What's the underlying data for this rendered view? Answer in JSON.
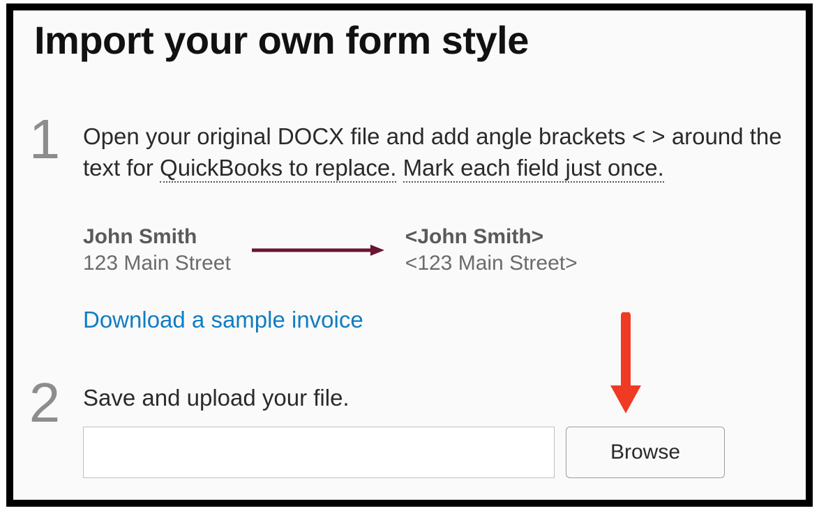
{
  "title": "Import your own form style",
  "step1": {
    "num": "1",
    "text_before": "Open your original DOCX file and add angle brackets < > around the text for ",
    "dotted1": "QuickBooks to replace.",
    "space": " ",
    "dotted2": "Mark each field just once.",
    "example_left_name": "John Smith",
    "example_left_addr": "123 Main Street",
    "example_right_name": "<John Smith>",
    "example_right_addr": "<123 Main Street>",
    "download_link": "Download a sample invoice"
  },
  "step2": {
    "num": "2",
    "text": "Save and upload your file.",
    "file_value": "",
    "browse_label": "Browse"
  }
}
